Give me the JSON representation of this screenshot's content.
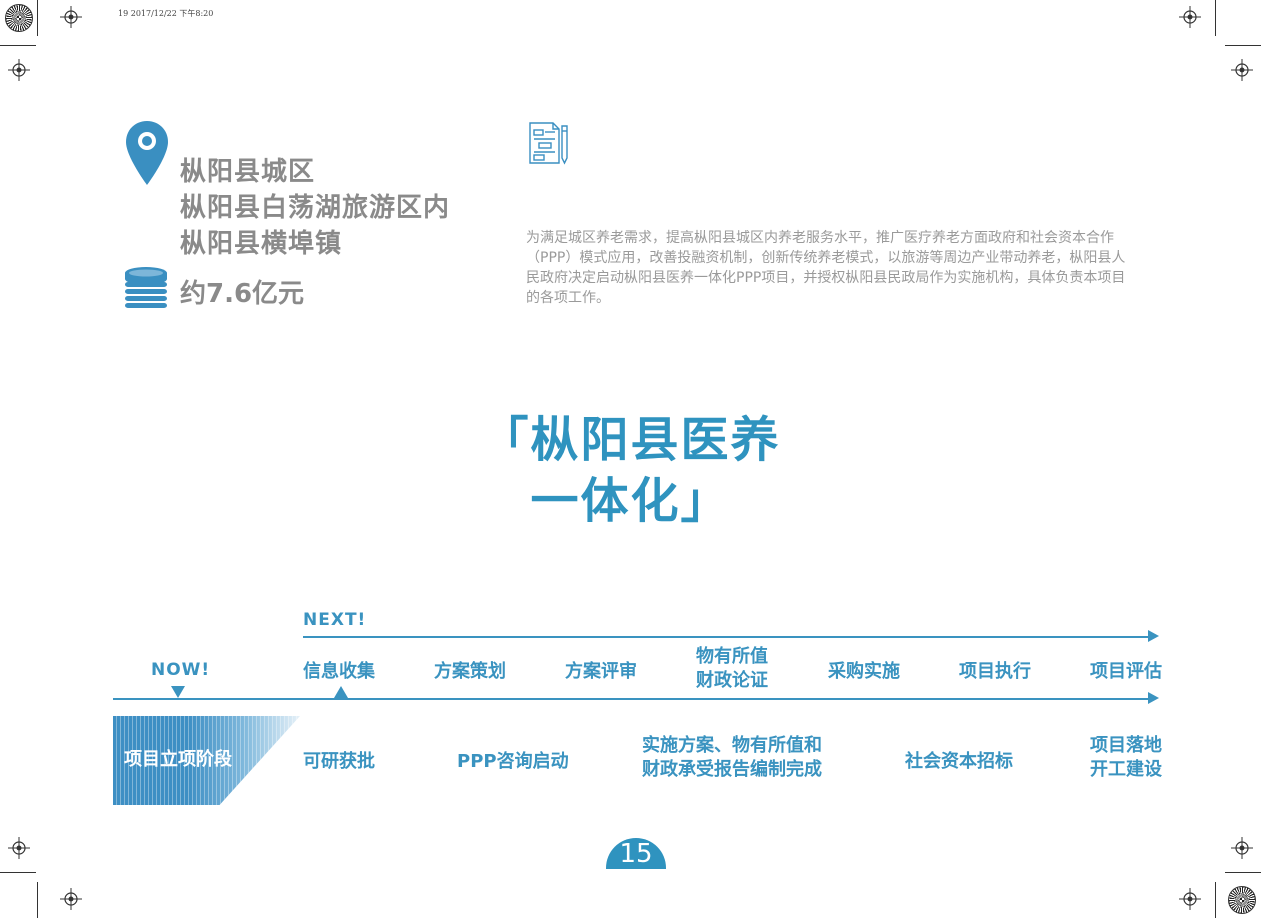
{
  "slug": "19   2017/12/22   下午8:20",
  "location": {
    "lines": [
      "枞阳县城区",
      "枞阳县白荡湖旅游区内",
      "枞阳县横埠镇"
    ],
    "pin_icon": "map-pin-icon"
  },
  "investment": {
    "text": "约7.6亿元",
    "icon": "coin-stack-icon"
  },
  "document_icon": "document-pencil-icon",
  "description": "为满足城区养老需求，提高枞阳县城区内养老服务水平，推广医疗养老方面政府和社会资本合作（PPP）模式应用，改善投融资机制，创新传统养老模式，以旅游等周边产业带动养老，枞阳县人民政府决定启动枞阳县医养一体化PPP项目，并授权枞阳县民政局作为实施机构，具体负责本项目的各项工作。",
  "title": {
    "line1": "「枞阳县医养",
    "line2": "一体化」"
  },
  "timeline": {
    "next_label": "NEXT!",
    "now_label": "NOW!",
    "stages": [
      "信息收集",
      "方案策划",
      "方案评审",
      "物有所值\n财政论证",
      "采购实施",
      "项目执行",
      "项目评估"
    ],
    "current_phase": "项目立项阶段",
    "milestones": [
      "可研获批",
      "PPP咨询启动",
      "实施方案、物有所值和\n财政承受报告编制完成",
      "社会资本招标",
      "项目落地\n开工建设"
    ],
    "accent_color": "#3a93c0"
  },
  "page_number": "15"
}
